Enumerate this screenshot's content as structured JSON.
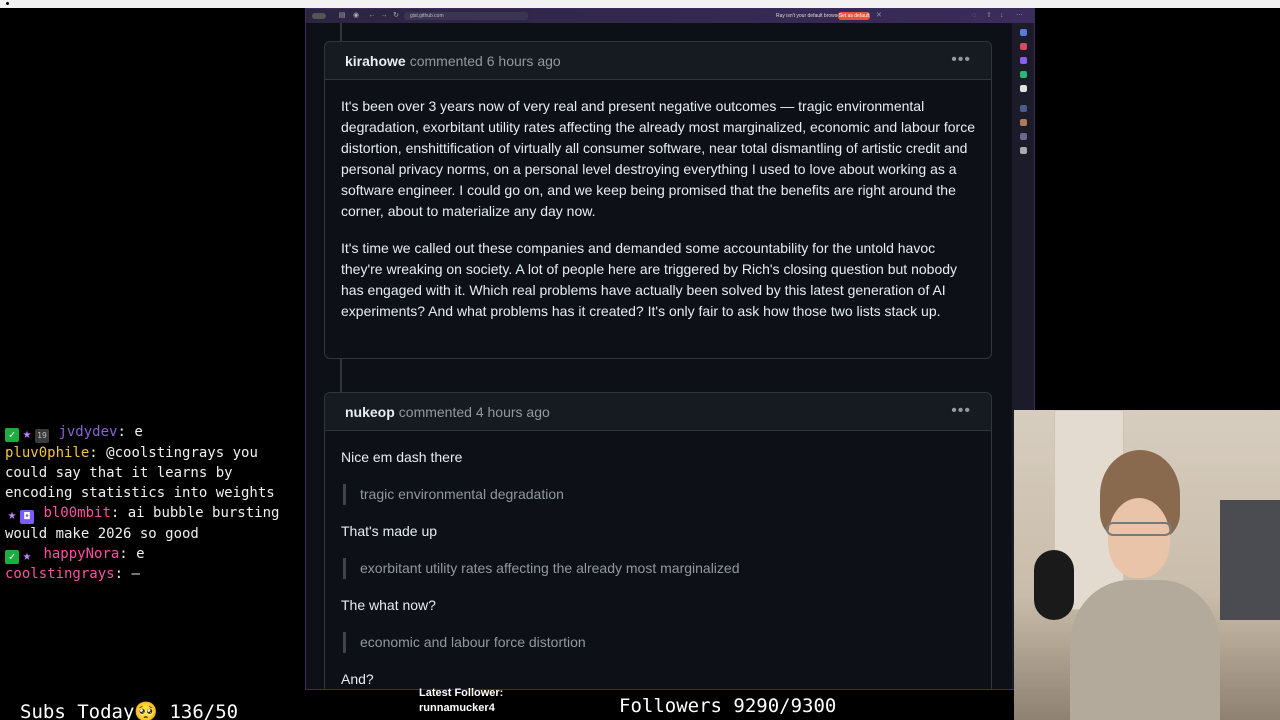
{
  "browser": {
    "url": "gist.github.com",
    "default_prompt": "Ray isn't your default browser",
    "default_button": "Set as default"
  },
  "comments": [
    {
      "author": "kirahowe",
      "meta": "commented 6 hours ago",
      "paragraphs": [
        "It's been over 3 years now of very real and present negative outcomes — tragic environmental degradation, exorbitant utility rates affecting the already most marginalized, economic and labour force distortion, enshittification of virtually all consumer software, near total dismantling of artistic credit and personal privacy norms, on a personal level destroying everything I used to love about working as a software engineer. I could go on, and we keep being promised that the benefits are right around the corner, about to materialize any day now.",
        "It's time we called out these companies and demanded some accountability for the untold havoc they're wreaking on society. A lot of people here are triggered by Rich's closing question but nobody has engaged with it. Which real problems have actually been solved by this latest generation of AI experiments? And what problems has it created? It's only fair to ask how those two lists stack up."
      ]
    },
    {
      "author": "nukeop",
      "meta": "commented 4 hours ago",
      "blocks": {
        "p1": "Nice em dash there",
        "q1": "tragic environmental degradation",
        "p2": "That's made up",
        "q2": "exorbitant utility rates affecting the already most marginalized",
        "p3": "The what now?",
        "q3": "economic and labour force distortion",
        "p4": "And?"
      }
    }
  ],
  "chat": [
    {
      "user": "jvdydev",
      "color": "#8a63d2",
      "text": "e"
    },
    {
      "user": "pluv0phile",
      "color": "#f5c542",
      "text": "@coolstingrays you could say that it learns by encoding statistics into weights"
    },
    {
      "user": "bl00mbit",
      "color": "#ff4fa3",
      "text": "ai bubble bursting would make 2026 so good"
    },
    {
      "user": "happyNora",
      "color": "#ff4fa3",
      "text": "e"
    },
    {
      "user": "coolstingrays",
      "color": "#ff4fa3",
      "text": "—"
    }
  ],
  "overlay": {
    "subs": "Subs Today🥺 136/50",
    "latest_follower_label": "Latest Follower:",
    "latest_follower_name": "runnamucker4",
    "followers": "Followers 9290/9300"
  },
  "icons": {
    "kebab": "kebab-menu-icon",
    "mod_badge": "moderator-badge-icon",
    "star_badge": "star-badge-icon"
  }
}
